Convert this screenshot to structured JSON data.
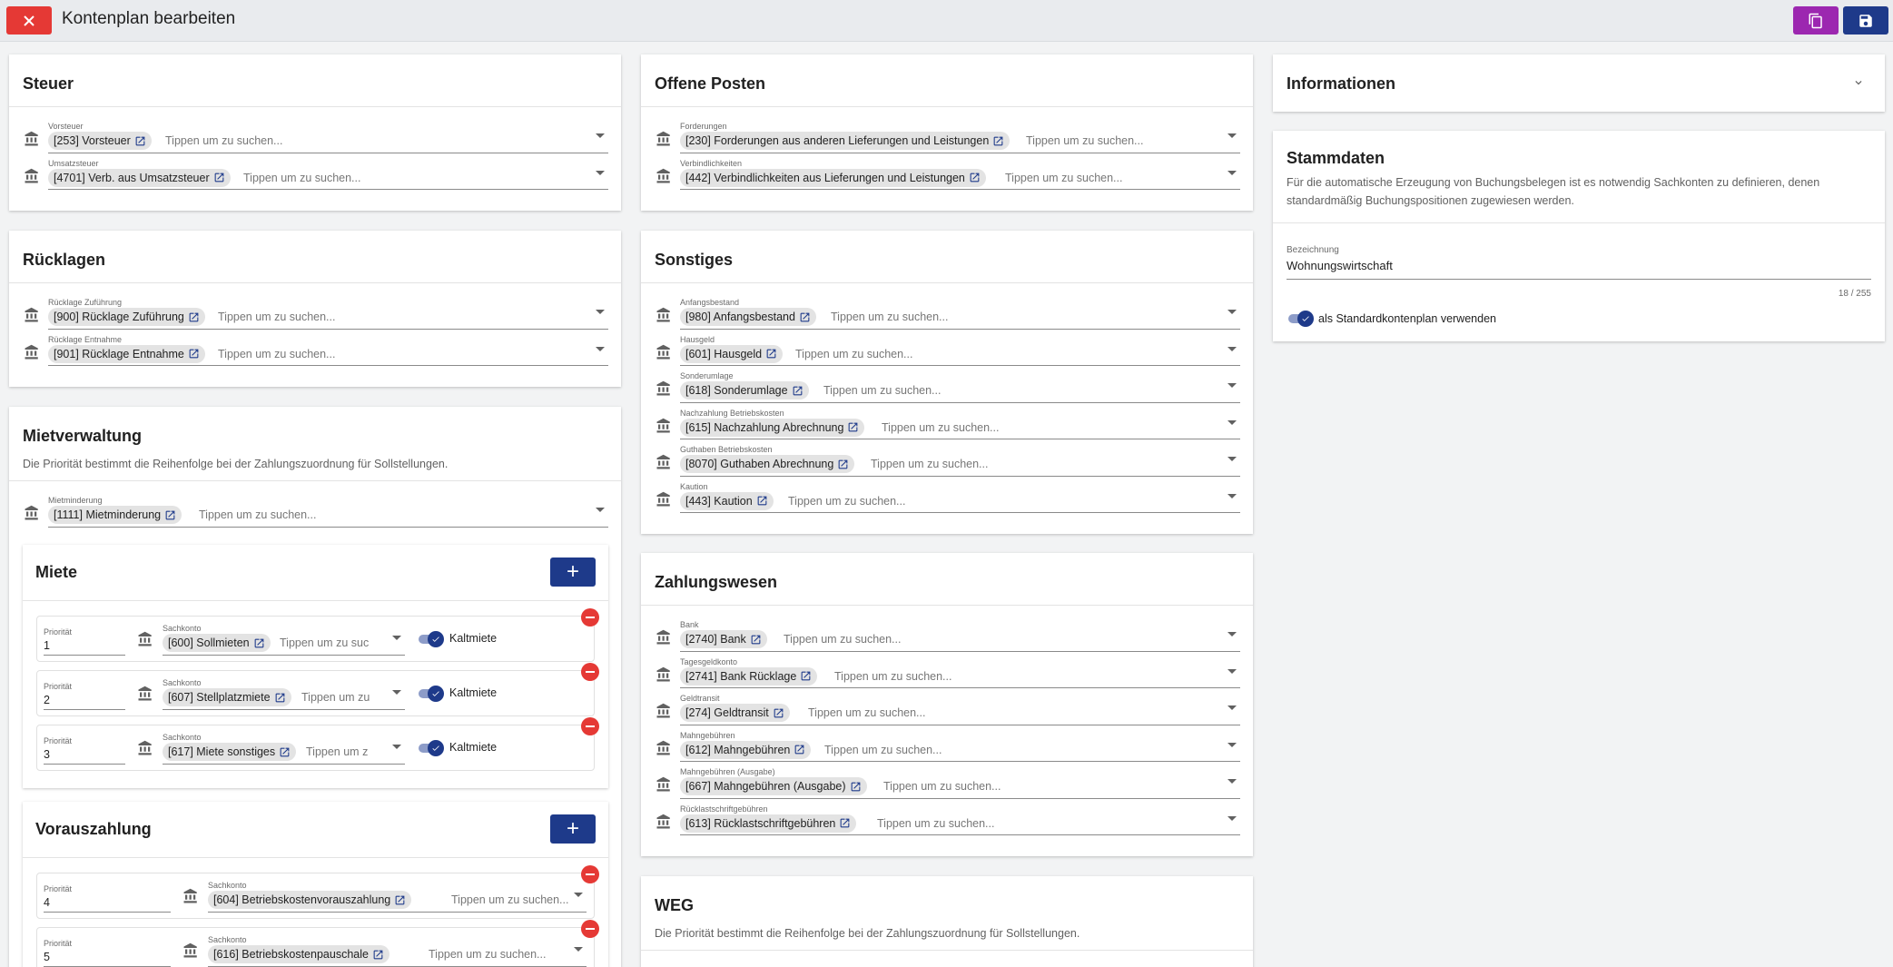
{
  "header": {
    "title": "Kontenplan bearbeiten"
  },
  "steuer": {
    "title": "Steuer",
    "fields": [
      {
        "label": "Vorsteuer",
        "value": "[253] Vorsteuer",
        "placeholder": "Tippen um zu suchen..."
      },
      {
        "label": "Umsatzsteuer",
        "value": "[4701] Verb. aus Umsatzsteuer",
        "placeholder": "Tippen um zu suchen..."
      }
    ]
  },
  "ruecklagen": {
    "title": "Rücklagen",
    "fields": [
      {
        "label": "Rücklage Zuführung",
        "value": "[900] Rücklage Zuführung",
        "placeholder": "Tippen um zu suchen..."
      },
      {
        "label": "Rücklage Entnahme",
        "value": "[901] Rücklage Entnahme",
        "placeholder": "Tippen um zu suchen..."
      }
    ]
  },
  "mietverwaltung": {
    "title": "Mietverwaltung",
    "subtitle": "Die Priorität bestimmt die Reihenfolge bei der Zahlungszuordnung für Sollstellungen.",
    "field": {
      "label": "Mietminderung",
      "value": "[1111] Mietminderung",
      "placeholder": "Tippen um zu suchen..."
    },
    "miete": {
      "title": "Miete",
      "rows": [
        {
          "prio_label": "Priorität",
          "prio": "1",
          "label": "Sachkonto",
          "value": "[600] Sollmieten",
          "placeholder": "Tippen um zu suc",
          "toggle_label": "Kaltmiete",
          "toggle_on": true
        },
        {
          "prio_label": "Priorität",
          "prio": "2",
          "label": "Sachkonto",
          "value": "[607] Stellplatzmiete",
          "placeholder": "Tippen um zu",
          "toggle_label": "Kaltmiete",
          "toggle_on": true
        },
        {
          "prio_label": "Priorität",
          "prio": "3",
          "label": "Sachkonto",
          "value": "[617] Miete sonstiges",
          "placeholder": "Tippen um z",
          "toggle_label": "Kaltmiete",
          "toggle_on": true
        }
      ]
    },
    "vorauszahlung": {
      "title": "Vorauszahlung",
      "rows": [
        {
          "prio_label": "Priorität",
          "prio": "4",
          "label": "Sachkonto",
          "value": "[604] Betriebskostenvorauszahlung",
          "placeholder": "Tippen um zu suchen..."
        },
        {
          "prio_label": "Priorität",
          "prio": "5",
          "label": "Sachkonto",
          "value": "[616] Betriebskostenpauschale",
          "placeholder": "Tippen um zu suchen..."
        }
      ]
    }
  },
  "offene_posten": {
    "title": "Offene Posten",
    "fields": [
      {
        "label": "Forderungen",
        "value": "[230] Forderungen aus anderen Lieferungen und Leistungen",
        "placeholder": "Tippen um zu suchen..."
      },
      {
        "label": "Verbindlichkeiten",
        "value": "[442] Verbindlichkeiten aus Lieferungen und Leistungen",
        "placeholder": "Tippen um zu suchen..."
      }
    ]
  },
  "sonstiges": {
    "title": "Sonstiges",
    "fields": [
      {
        "label": "Anfangsbestand",
        "value": "[980] Anfangsbestand",
        "placeholder": "Tippen um zu suchen..."
      },
      {
        "label": "Hausgeld",
        "value": "[601] Hausgeld",
        "placeholder": "Tippen um zu suchen..."
      },
      {
        "label": "Sonderumlage",
        "value": "[618] Sonderumlage",
        "placeholder": "Tippen um zu suchen..."
      },
      {
        "label": "Nachzahlung Betriebskosten",
        "value": "[615] Nachzahlung Abrechnung",
        "placeholder": "Tippen um zu suchen..."
      },
      {
        "label": "Guthaben Betriebskosten",
        "value": "[8070] Guthaben Abrechnung",
        "placeholder": "Tippen um zu suchen..."
      },
      {
        "label": "Kaution",
        "value": "[443] Kaution",
        "placeholder": "Tippen um zu suchen..."
      }
    ]
  },
  "zahlungswesen": {
    "title": "Zahlungswesen",
    "fields": [
      {
        "label": "Bank",
        "value": "[2740] Bank",
        "placeholder": "Tippen um zu suchen..."
      },
      {
        "label": "Tagesgeldkonto",
        "value": "[2741] Bank Rücklage",
        "placeholder": "Tippen um zu suchen..."
      },
      {
        "label": "Geldtransit",
        "value": "[274] Geldtransit",
        "placeholder": "Tippen um zu suchen..."
      },
      {
        "label": "Mahngebühren",
        "value": "[612] Mahngebühren",
        "placeholder": "Tippen um zu suchen..."
      },
      {
        "label": "Mahngebühren (Ausgabe)",
        "value": "[667] Mahngebühren (Ausgabe)",
        "placeholder": "Tippen um zu suchen..."
      },
      {
        "label": "Rücklastschriftgebühren",
        "value": "[613] Rücklastschriftgebühren",
        "placeholder": "Tippen um zu suchen..."
      }
    ]
  },
  "weg": {
    "title": "WEG",
    "subtitle": "Die Priorität bestimmt die Reihenfolge bei der Zahlungszuordnung für Sollstellungen."
  },
  "informationen": {
    "title": "Informationen"
  },
  "stammdaten": {
    "title": "Stammdaten",
    "description": "Für die automatische Erzeugung von Buchungsbelegen ist es notwendig Sachkonten zu definieren, denen standardmäßig Buchungspositionen zugewiesen werden.",
    "name_label": "Bezeichnung",
    "name_value": "Wohnungswirtschaft",
    "counter": "18 / 255",
    "toggle_label": "als Standardkontenplan verwenden",
    "toggle_on": true
  },
  "colors": {
    "danger": "#e53935",
    "primary": "#1e3a8a",
    "accent": "#9c27b0"
  }
}
